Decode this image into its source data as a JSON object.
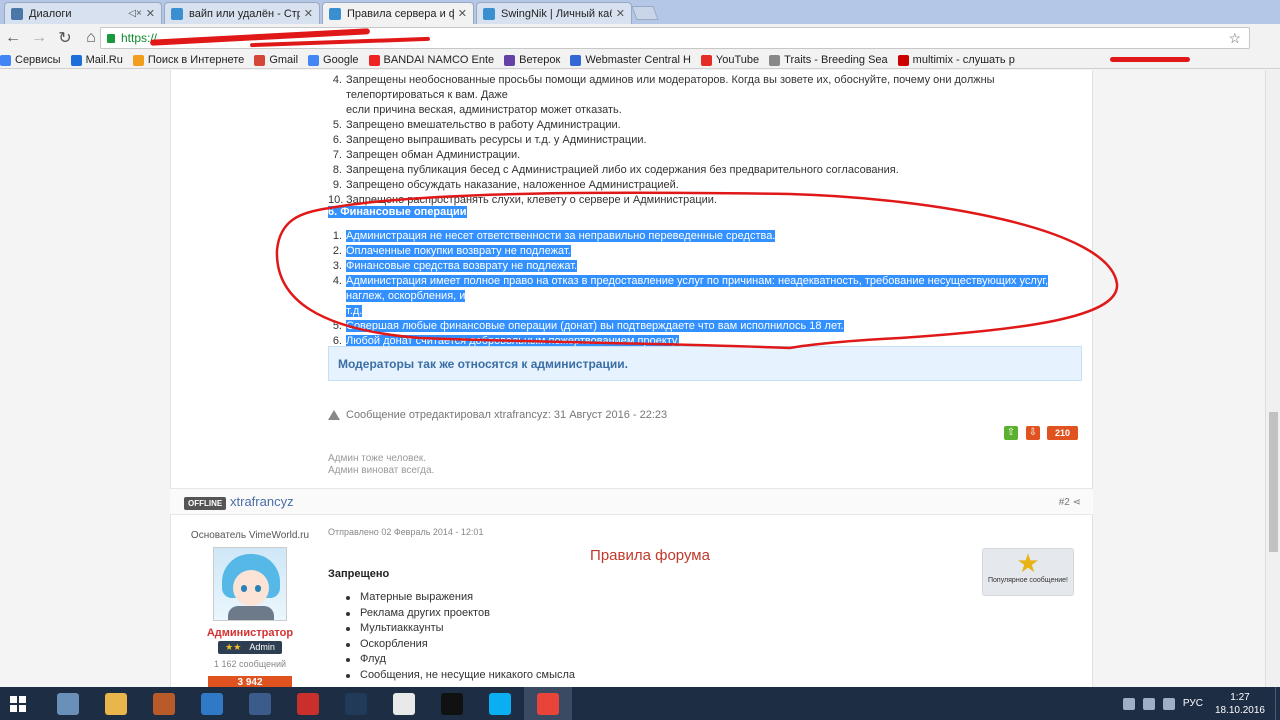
{
  "browser": {
    "tabs": [
      {
        "title": "Диалоги",
        "favicon_color": "#4a76a8",
        "muted": true
      },
      {
        "title": "вайп или удалён - Стра",
        "favicon_color": "#3a8fd0"
      },
      {
        "title": "Правила сервера и фор",
        "favicon_color": "#3a8fd0",
        "active": true
      },
      {
        "title": "SwingNik | Личный каб",
        "favicon_color": "#3a8fd0"
      }
    ],
    "url_visible": "https://",
    "bookmarks": [
      {
        "label": "Сервисы",
        "color": "#4285f4"
      },
      {
        "label": "Mail.Ru",
        "color": "#1c6fd9"
      },
      {
        "label": "Поиск в Интернете",
        "color": "#f29d1b"
      },
      {
        "label": "Gmail",
        "color": "#d44638"
      },
      {
        "label": "Google",
        "color": "#4285f4"
      },
      {
        "label": "BANDAI NAMCO Ente",
        "color": "#e22"
      },
      {
        "label": "Ветерок",
        "color": "#6441a5"
      },
      {
        "label": "Webmaster Central H",
        "color": "#3367d6"
      },
      {
        "label": "YouTube",
        "color": "#e52d27"
      },
      {
        "label": "Traits - Breeding Sea",
        "color": "#888"
      },
      {
        "label": "multimix - слушать р",
        "color": "#c00"
      }
    ]
  },
  "rules_top": [
    {
      "num": "4.",
      "text": "Запрещены необоснованные просьбы помощи админов или модераторов. Когда вы зовете их, обоснуйте, почему они должны телепортироваться к вам. Даже"
    },
    {
      "num": "",
      "text": "если причина веская, администратор может отказать."
    },
    {
      "num": "5.",
      "text": "Запрещено вмешательство в работу Администрации."
    },
    {
      "num": "6.",
      "text": "Запрещено выпрашивать ресурсы и т.д. у Администрации."
    },
    {
      "num": "7.",
      "text": "Запрещен обман Администрации."
    },
    {
      "num": "8.",
      "text": "Запрещена публикация бесед с Администрацией либо их содержания без предварительного согласования."
    },
    {
      "num": "9.",
      "text": "Запрещено обсуждать наказание, наложенное Администрацией."
    },
    {
      "num": "10.",
      "text": "Запрещено распространять слухи, клевету о сервере и Администрации."
    }
  ],
  "finance_section": {
    "title": "6. Финансовые операции",
    "items": [
      {
        "num": "1.",
        "text": "Администрация не несет ответственности за неправильно переведенные средства."
      },
      {
        "num": "2.",
        "text": "Оплаченные покупки возврату не подлежат."
      },
      {
        "num": "3.",
        "text": "Финансовые средства возврату не подлежат."
      },
      {
        "num": "4.",
        "text": "Администрация имеет полное право на отказ в предоставление услуг по причинам: неадекватность, требование несуществующих услуг, наглеж, оскорбления, и"
      },
      {
        "num": "",
        "text": "т.д."
      },
      {
        "num": "5.",
        "text": "Совершая любые финансовые операции (донат) вы подтверждаете что вам исполнилось 18 лет."
      },
      {
        "num": "6.",
        "text": "Любой донат считается добровольным пожертвованием проекту."
      }
    ]
  },
  "moderators_note": "Модераторы так же относятся к администрации.",
  "edit_note": "Сообщение отредактировал xtrafrancyz: 31 Август 2016 - 22:23",
  "vote_up": "⇧",
  "vote_down": "⇩",
  "reputation": "210",
  "signature": [
    "Админ тоже человек.",
    "Админ виноват всегда."
  ],
  "post2": {
    "status": "OFFLINE",
    "username": "xtrafrancyz",
    "post_number": "#2",
    "author_title": "Основатель VimeWorld.ru",
    "role": "Администратор",
    "badge_stars": "★★",
    "badge_label": "Admin",
    "message_count": "1 162 сообщений",
    "reputation": "3 942",
    "date": "Отправлено 02 Февраль 2014 - 12:01",
    "heading": "Правила форума",
    "popular_label": "Популярное сообщение!",
    "forbidden_title": "Запрещено",
    "forbidden_items": [
      "Матерные выражения",
      "Реклама других проектов",
      "Мультиаккаунты",
      "Оскорбления",
      "Флуд",
      "Сообщения, не несущие никакого смысла"
    ]
  },
  "taskbar": {
    "language": "РУС",
    "time": "1:27",
    "date": "18.10.2016",
    "apps": [
      {
        "name": "control-panel",
        "color": "#6a8fb8"
      },
      {
        "name": "explorer",
        "color": "#e8b64a"
      },
      {
        "name": "broom-app",
        "color": "#b85a2a"
      },
      {
        "name": "remote-app",
        "color": "#2f79c6"
      },
      {
        "name": "lol-app",
        "color": "#3b5c8a"
      },
      {
        "name": "kaspersky",
        "color": "#c9302c"
      },
      {
        "name": "steam",
        "color": "#223a5a"
      },
      {
        "name": "java",
        "color": "#e9e9e9"
      },
      {
        "name": "cmd",
        "color": "#111111"
      },
      {
        "name": "skype",
        "color": "#0aaff1"
      },
      {
        "name": "chrome",
        "color": "#e8443a",
        "active": true
      }
    ]
  }
}
